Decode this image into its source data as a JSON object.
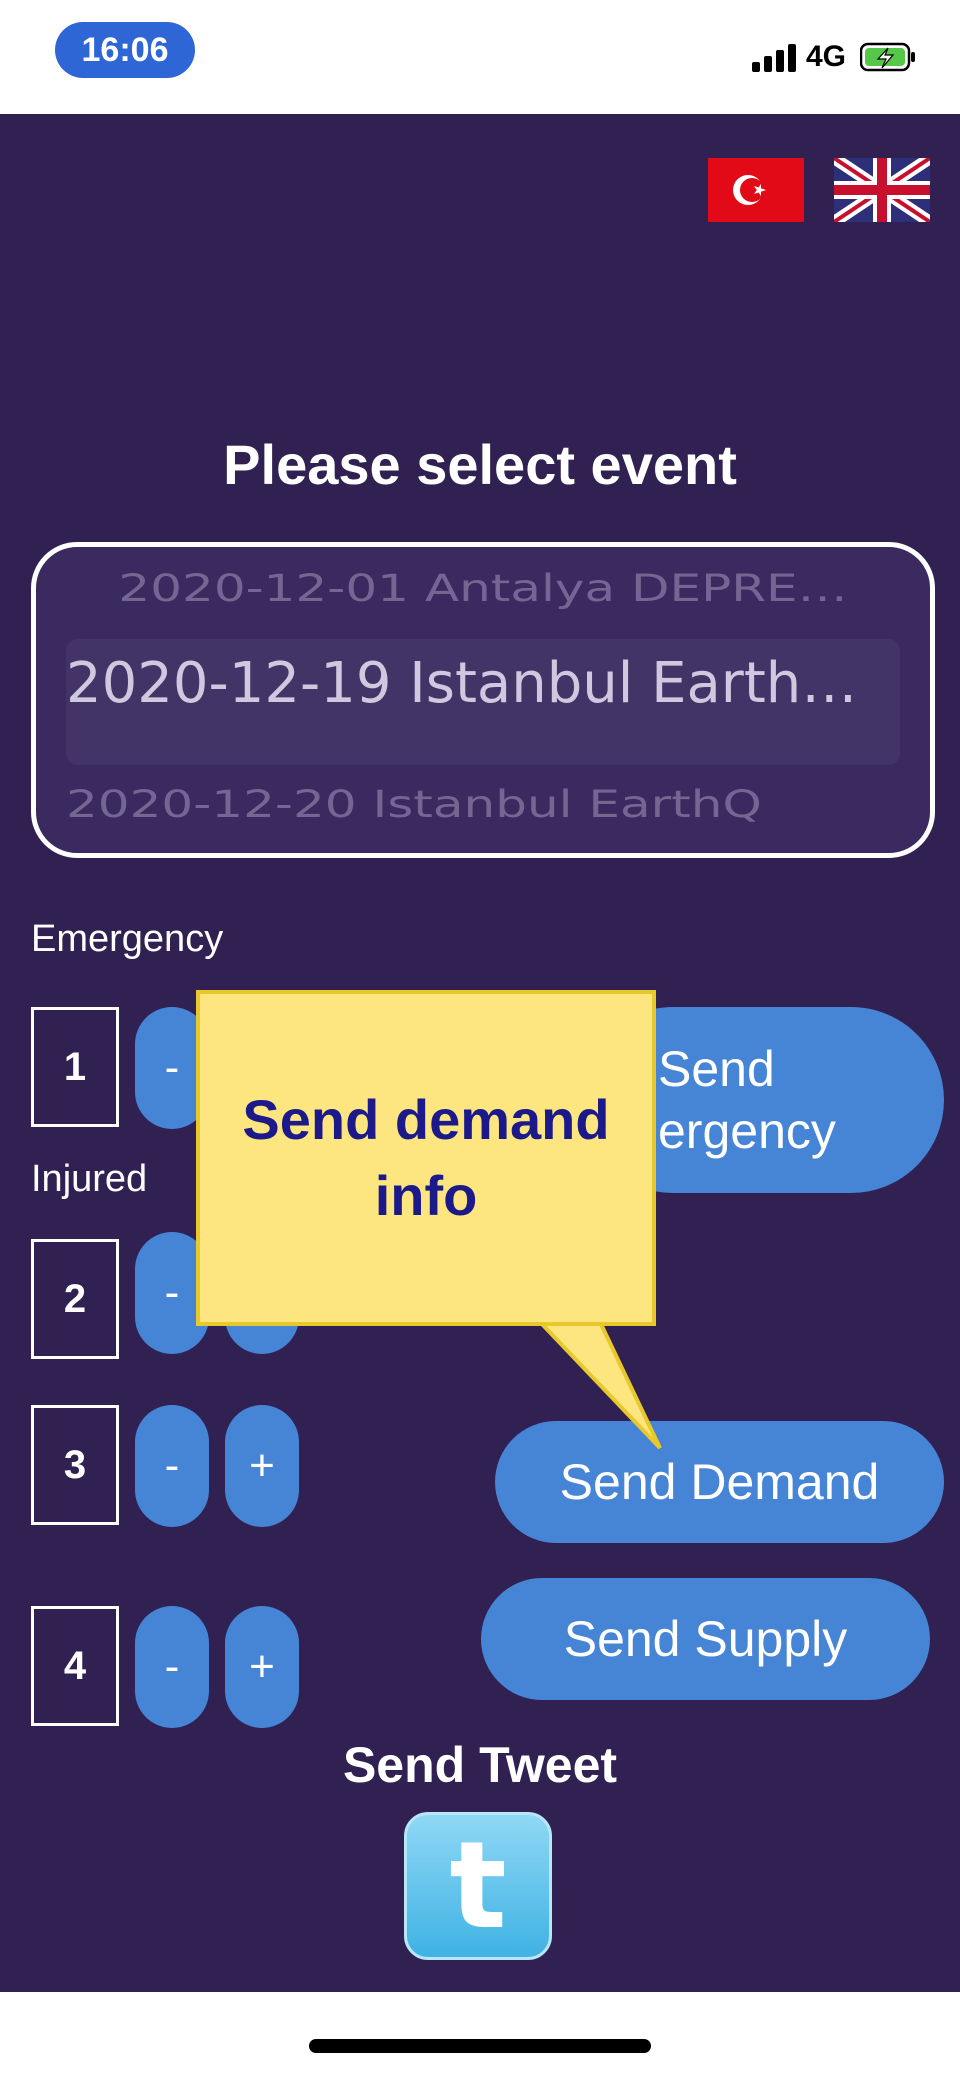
{
  "status_bar": {
    "time": "16:06",
    "network": "4G"
  },
  "event_picker": {
    "title": "Please select event",
    "options": [
      "2020-12-01 Antalya DEPRE…",
      "2020-12-19 Istanbul EarthQ…",
      "2020-12-20 Istanbul EarthQ"
    ],
    "selected": "2020-12-19 Istanbul EarthQ…"
  },
  "counters": [
    {
      "label": "Emergency",
      "value": "1",
      "minus": "-",
      "plus": "+"
    },
    {
      "label": "Injured",
      "value": "2",
      "minus": "-",
      "plus": "+"
    },
    {
      "label": "",
      "value": "3",
      "minus": "-",
      "plus": "+"
    },
    {
      "label": "",
      "value": "4",
      "minus": "-",
      "plus": "+"
    }
  ],
  "actions": {
    "send_emergency": "Send\nergency",
    "send_demand": "Send Demand",
    "send_supply": "Send Supply"
  },
  "tweet": {
    "label": "Send Tweet"
  },
  "callout": {
    "text": "Send demand info"
  },
  "colors": {
    "background": "#302152",
    "button": "#4684d6",
    "callout": "#fde67f",
    "callout_text": "#1c1a8a"
  }
}
